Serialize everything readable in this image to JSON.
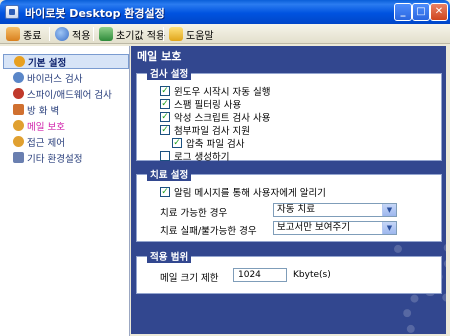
{
  "window": {
    "title": "바이로봇 Desktop 환경설정"
  },
  "toolbar": {
    "buttons": [
      {
        "label": "종료",
        "icon": "exit-icon"
      },
      {
        "label": "적용",
        "icon": "apply-icon"
      },
      {
        "label": "초기값 적용",
        "icon": "reset-icon"
      },
      {
        "label": "도움말",
        "icon": "help-icon"
      }
    ]
  },
  "sidebar": {
    "items": [
      {
        "label": "기본 설정",
        "color": "#E8A020"
      },
      {
        "label": "바이러스 검사",
        "color": "#5A86C8"
      },
      {
        "label": "스파이/애드웨어 검사",
        "color": "#C0392B"
      },
      {
        "label": "방 화 벽",
        "color": "#D07030"
      },
      {
        "label": "메일 보호",
        "color": "#E0A030"
      },
      {
        "label": "접근 제어",
        "color": "#E0A030"
      },
      {
        "label": "기타 환경설정",
        "color": "#6A7FB0"
      }
    ]
  },
  "main": {
    "title": "메일 보호",
    "scan_group": {
      "title": "검사 설정",
      "options": [
        {
          "label": "윈도우 시작시 자동 실행",
          "checked": true
        },
        {
          "label": "스팸 필터링 사용",
          "checked": true
        },
        {
          "label": "악성 스크립트 검사 사용",
          "checked": true
        },
        {
          "label": "첨부파일 검사 지원",
          "checked": true
        },
        {
          "label": "압축 파일 검사",
          "checked": true
        },
        {
          "label": "로그 생성하기",
          "checked": false
        }
      ]
    },
    "treat_group": {
      "title": "치료 설정",
      "alert_option": {
        "label": "알림 메시지를 통해 사용자에게 알리기",
        "checked": true
      },
      "curable_label": "치료 가능한 경우",
      "curable_value": "자동 치료",
      "fail_label": "치료 실패/불가능한 경우",
      "fail_value": "보고서만 보여주기"
    },
    "scope_group": {
      "title": "적용 범위",
      "size_label": "메일 크기 제한",
      "size_value": "1024",
      "size_unit": "Kbyte(s)"
    }
  },
  "colors": {
    "accent": "#32478F",
    "titlebar": "#0053E0",
    "check": "#21A121"
  }
}
